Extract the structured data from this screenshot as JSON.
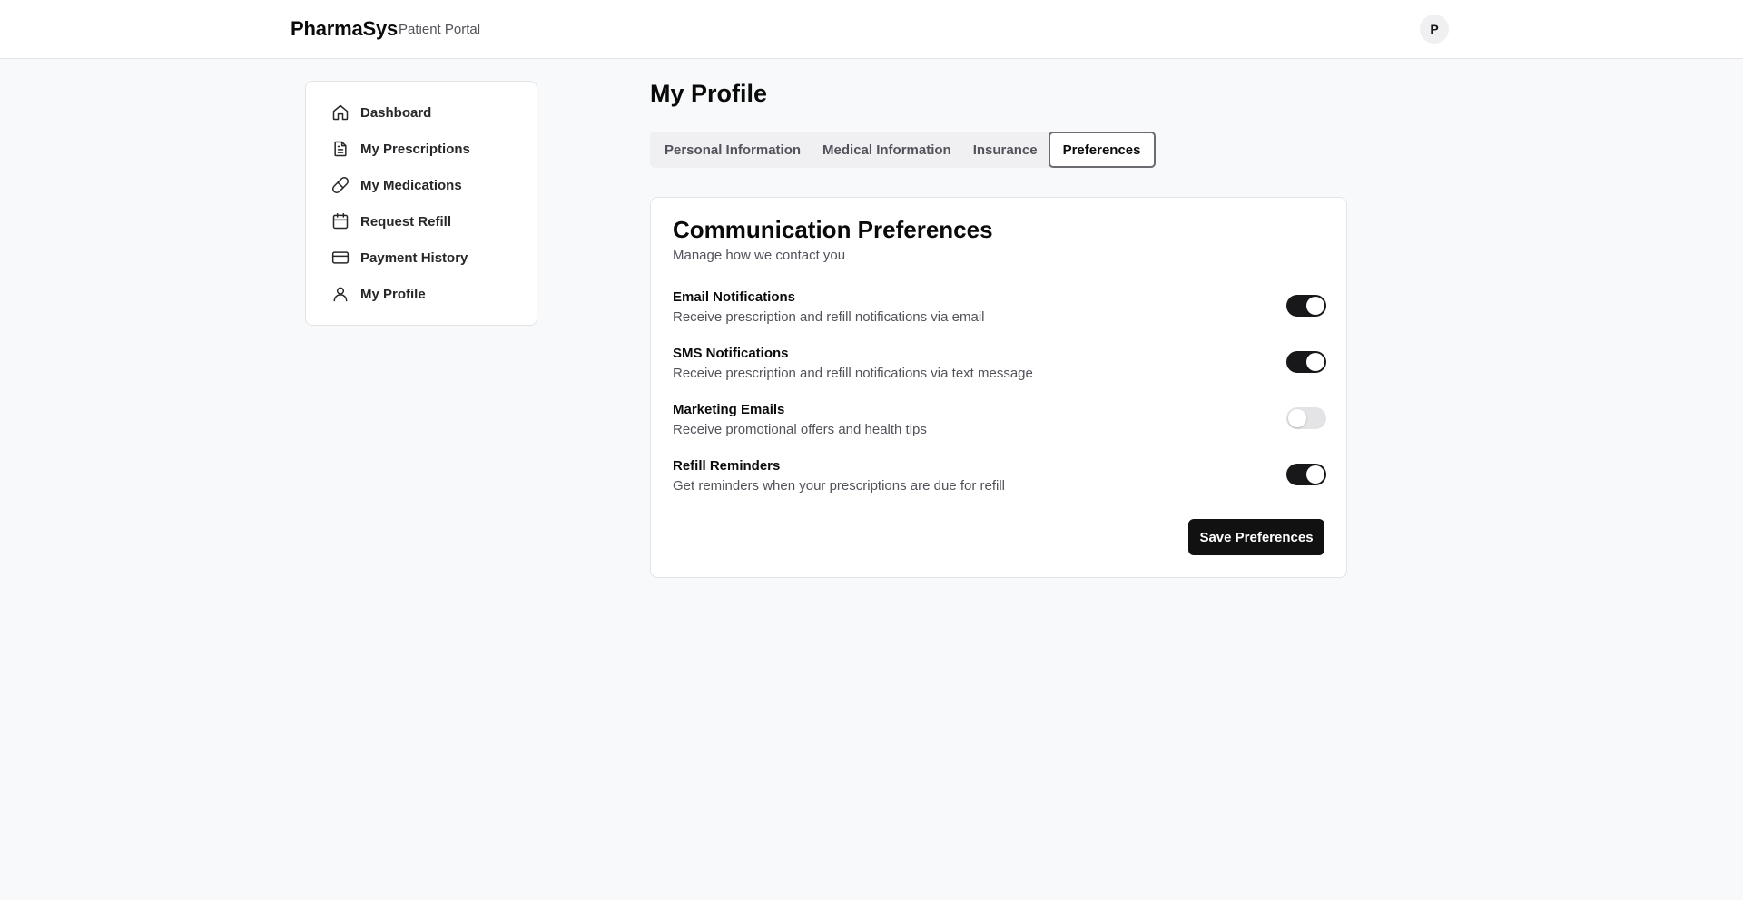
{
  "header": {
    "brand": "PharmaSys",
    "subtitle": "Patient Portal",
    "avatar_initial": "P"
  },
  "sidebar": {
    "items": [
      {
        "label": "Dashboard",
        "icon": "home-icon"
      },
      {
        "label": "My Prescriptions",
        "icon": "document-icon"
      },
      {
        "label": "My Medications",
        "icon": "pill-icon"
      },
      {
        "label": "Request Refill",
        "icon": "calendar-icon"
      },
      {
        "label": "Payment History",
        "icon": "credit-card-icon"
      },
      {
        "label": "My Profile",
        "icon": "user-icon"
      }
    ]
  },
  "main": {
    "title": "My Profile",
    "tabs": [
      {
        "label": "Personal Information",
        "active": false
      },
      {
        "label": "Medical Information",
        "active": false
      },
      {
        "label": "Insurance",
        "active": false
      },
      {
        "label": "Preferences",
        "active": true
      }
    ],
    "card": {
      "title": "Communication Preferences",
      "subtitle": "Manage how we contact you",
      "preferences": [
        {
          "label": "Email Notifications",
          "description": "Receive prescription and refill notifications via email",
          "enabled": true
        },
        {
          "label": "SMS Notifications",
          "description": "Receive prescription and refill notifications via text message",
          "enabled": true
        },
        {
          "label": "Marketing Emails",
          "description": "Receive promotional offers and health tips",
          "enabled": false
        },
        {
          "label": "Refill Reminders",
          "description": "Get reminders when your prescriptions are due for refill",
          "enabled": true
        }
      ],
      "save_label": "Save Preferences"
    }
  },
  "colors": {
    "toggle_on": "#18181b",
    "toggle_off": "#e4e4e7",
    "primary_button": "#111111",
    "background": "#f8f9fa"
  }
}
